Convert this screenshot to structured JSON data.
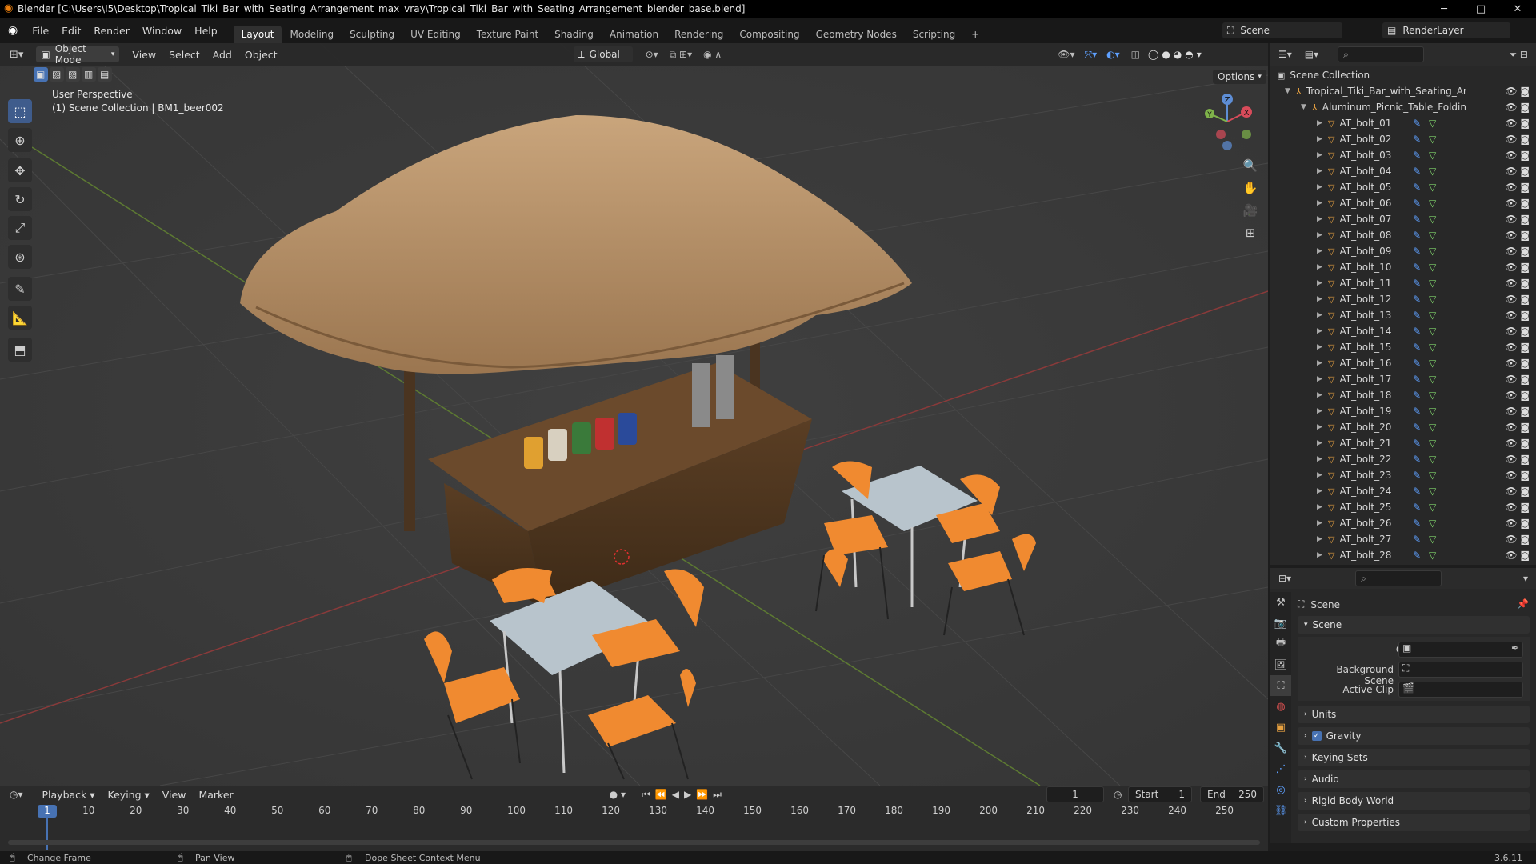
{
  "title_bar": {
    "title": "Blender [C:\\Users\\I5\\Desktop\\Tropical_Tiki_Bar_with_Seating_Arrangement_max_vray\\Tropical_Tiki_Bar_with_Seating_Arrangement_blender_base.blend]",
    "minimize": "─",
    "maximize": "□",
    "close": "✕"
  },
  "menu": [
    "File",
    "Edit",
    "Render",
    "Window",
    "Help"
  ],
  "workspaces": [
    "Layout",
    "Modeling",
    "Sculpting",
    "UV Editing",
    "Texture Paint",
    "Shading",
    "Animation",
    "Rendering",
    "Compositing",
    "Geometry Nodes",
    "Scripting",
    "+"
  ],
  "scene": {
    "label": "Scene",
    "render_layer": "RenderLayer"
  },
  "viewport": {
    "mode": "Object Mode",
    "menus": [
      "View",
      "Select",
      "Add",
      "Object"
    ],
    "transform": "Global",
    "options": "Options",
    "perspective": "User Perspective",
    "collection": "(1) Scene Collection | BM1_beer002",
    "gizmo": {
      "x": "X",
      "y": "Y",
      "z": "Z"
    }
  },
  "outliner": {
    "root": "Scene Collection",
    "collection": "Tropical_Tiki_Bar_with_Seating_Arrange",
    "sub": "Aluminum_Picnic_Table_Folding_va",
    "items": [
      "AT_bolt_01",
      "AT_bolt_02",
      "AT_bolt_03",
      "AT_bolt_04",
      "AT_bolt_05",
      "AT_bolt_06",
      "AT_bolt_07",
      "AT_bolt_08",
      "AT_bolt_09",
      "AT_bolt_10",
      "AT_bolt_11",
      "AT_bolt_12",
      "AT_bolt_13",
      "AT_bolt_14",
      "AT_bolt_15",
      "AT_bolt_16",
      "AT_bolt_17",
      "AT_bolt_18",
      "AT_bolt_19",
      "AT_bolt_20",
      "AT_bolt_21",
      "AT_bolt_22",
      "AT_bolt_23",
      "AT_bolt_24",
      "AT_bolt_25",
      "AT_bolt_26",
      "AT_bolt_27",
      "AT_bolt_28"
    ]
  },
  "properties": {
    "breadcrumb": "Scene",
    "panel": "Scene",
    "camera": "Camera",
    "background_scene": "Background Scene",
    "active_clip": "Active Clip",
    "sections": [
      "Units",
      "Gravity",
      "Keying Sets",
      "Audio",
      "Rigid Body World",
      "Custom Properties"
    ]
  },
  "timeline": {
    "menus": [
      "Playback",
      "Keying",
      "View",
      "Marker"
    ],
    "current_frame": "1",
    "start_label": "Start",
    "start": "1",
    "end_label": "End",
    "end": "250",
    "ticks": [
      "1",
      "10",
      "20",
      "30",
      "40",
      "50",
      "60",
      "70",
      "80",
      "90",
      "100",
      "110",
      "120",
      "130",
      "140",
      "150",
      "160",
      "170",
      "180",
      "190",
      "200",
      "210",
      "220",
      "230",
      "240",
      "250"
    ]
  },
  "status": {
    "left": "Change Frame",
    "middle": "Pan View",
    "right": "Dope Sheet Context Menu",
    "version": "3.6.11"
  }
}
